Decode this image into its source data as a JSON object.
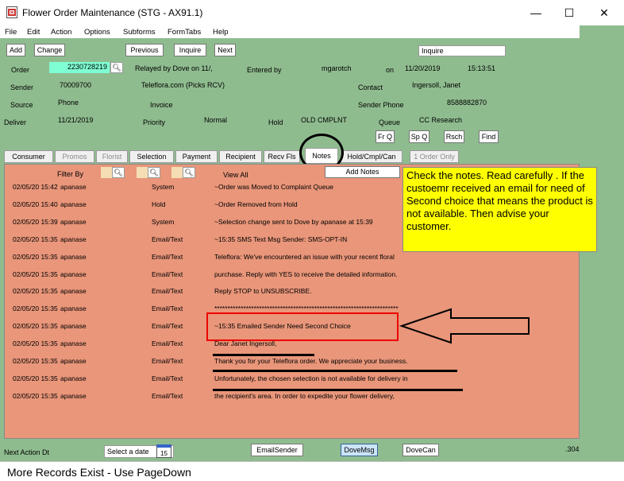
{
  "window": {
    "title": "Flower Order Maintenance (STG - AX91.1)",
    "minimize": "—",
    "maximize": "☐",
    "close": "✕"
  },
  "menu": [
    "File",
    "Edit",
    "Action",
    "Options",
    "Subforms",
    "FormTabs",
    "Help"
  ],
  "toolbar": {
    "add": "Add",
    "change": "Change",
    "previous": "Previous",
    "inquire": "Inquire",
    "next": "Next",
    "mode": "Inquire"
  },
  "order": {
    "order_label": "Order",
    "order_value": "2230728219",
    "relayed": "Relayed by Dove on 11/,",
    "entered_label": "Entered by",
    "entered_value": "mgarotch",
    "on_label": "on",
    "on_date": "11/20/2019",
    "on_time": "15:13:51",
    "sender_label": "Sender",
    "sender_value": "70009700",
    "sender_name": "Teleflora.com (Picks RCV)",
    "contact_label": "Contact",
    "contact_value": "Ingersoll, Janet",
    "source_label": "Source",
    "source_value": "Phone",
    "invoice_label": "Invoice",
    "sender_phone_label": "Sender Phone",
    "sender_phone_value": "8588882870",
    "deliver_label": "Deliver",
    "deliver_value": "11/21/2019",
    "priority_label": "Priority",
    "priority_value": "Normal",
    "hold_label": "Hold",
    "hold_value": "OLD CMPLNT",
    "queue_label": "Queue",
    "queue_value": "CC Research"
  },
  "queue_buttons": [
    "Fr Q",
    "Sp Q",
    "Rsch",
    "Find"
  ],
  "tabs": [
    "Consumer",
    "Promos",
    "Florist",
    "Selection",
    "Payment",
    "Recipient",
    "Recv Fls",
    "Notes",
    "Hold/Cmpl/Can",
    "1 Order Only"
  ],
  "notes": {
    "filter_label": "Filter By",
    "view_all": "View All",
    "add_notes": "Add Notes",
    "rows": [
      {
        "dt": "02/05/20 15:42",
        "user": "apanase",
        "type": "System",
        "text": "~Order was Moved to     Complaint       Queue"
      },
      {
        "dt": "02/05/20 15:40",
        "user": "apanase",
        "type": "Hold",
        "text": "~Order Removed from Hold"
      },
      {
        "dt": "02/05/20 15:39",
        "user": "apanase",
        "type": "System",
        "text": "~Selection change sent to Dove by apanase at 15:39"
      },
      {
        "dt": "02/05/20 15:35",
        "user": "apanase",
        "type": "Email/Text",
        "text": "~15:35  SMS Text Msg Sender: SMS-OPT-IN"
      },
      {
        "dt": "02/05/20 15:35",
        "user": "apanase",
        "type": "Email/Text",
        "text": "Teleflora: We've encountered an issue with your recent floral"
      },
      {
        "dt": "02/05/20 15:35",
        "user": "apanase",
        "type": "Email/Text",
        "text": "purchase. Reply  with YES to receive the detailed information."
      },
      {
        "dt": "02/05/20 15:35",
        "user": "apanase",
        "type": "Email/Text",
        "text": "Reply STOP to UNSUBSCRIBE."
      },
      {
        "dt": "02/05/20 15:35",
        "user": "apanase",
        "type": "Email/Text",
        "text": "**********************************************************************"
      },
      {
        "dt": "02/05/20 15:35",
        "user": "apanase",
        "type": "Email/Text",
        "text": "~15:35  Emailed Sender  Need Second Choice"
      },
      {
        "dt": "02/05/20 15:35",
        "user": "apanase",
        "type": "Email/Text",
        "text": "Dear Janet Ingersoll,"
      },
      {
        "dt": "02/05/20 15:35",
        "user": "apanase",
        "type": "Email/Text",
        "text": "Thank you for your Teleflora order.  We appreciate your business."
      },
      {
        "dt": "02/05/20 15:35",
        "user": "apanase",
        "type": "Email/Text",
        "text": "Unfortunately, the chosen selection is not available for delivery in"
      },
      {
        "dt": "02/05/20 15:35",
        "user": "apanase",
        "type": "Email/Text",
        "text": "the recipient's area.  In order to expedite your flower delivery,"
      }
    ]
  },
  "callout": "Check the notes. Read carefully . If the custoemr received an email for need of Second choice that means the product is not available. Then advise your customer.",
  "bottom": {
    "next_action": "Next Action Dt",
    "select_date": "Select a date",
    "cal_day": "15",
    "email_sender": "EmailSender",
    "dove_msg": "DoveMsg",
    "dove_can": "DoveCan",
    "right_val": ".304"
  },
  "status": "More Records Exist - Use PageDown"
}
